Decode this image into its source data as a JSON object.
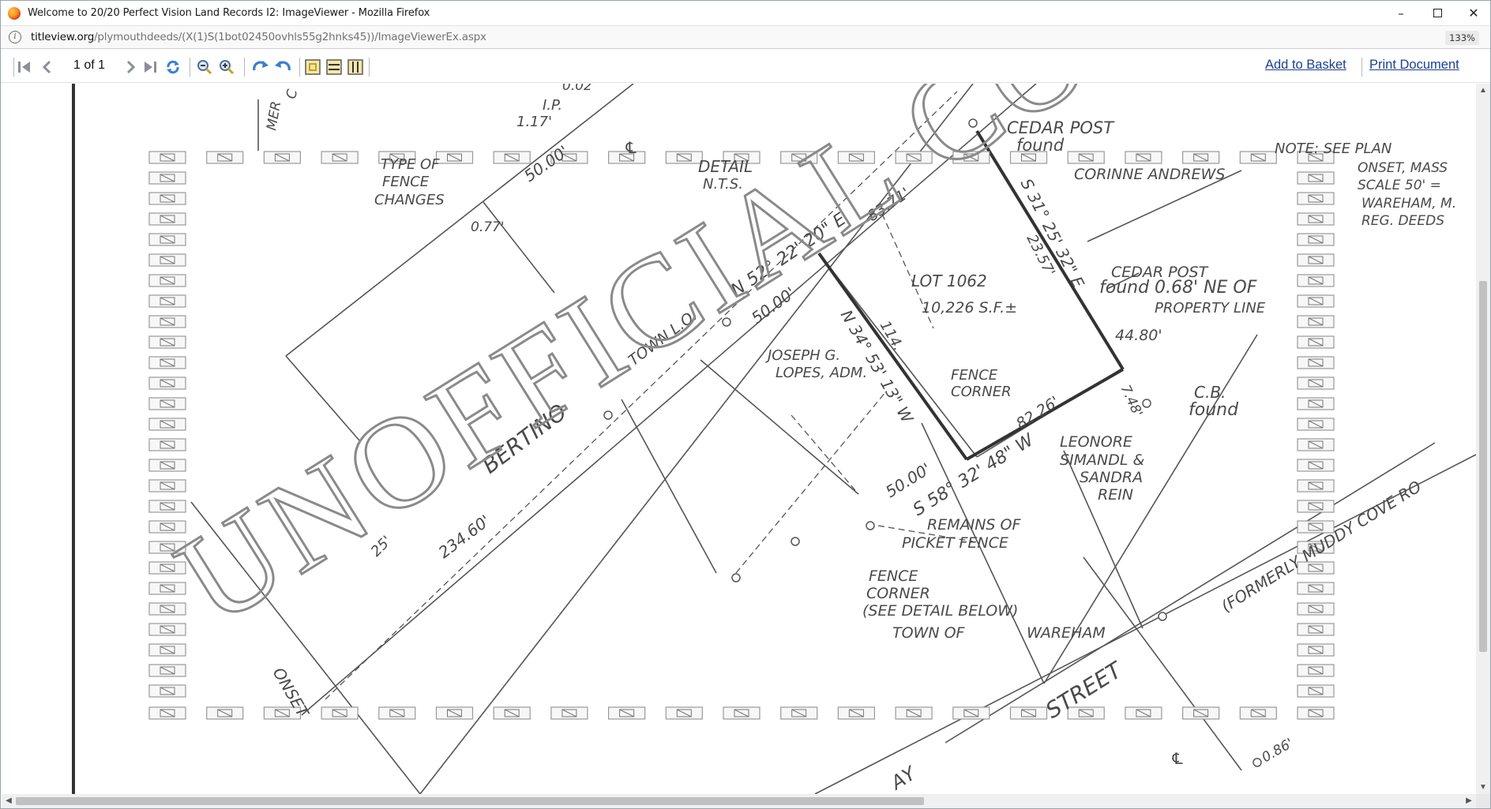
{
  "window": {
    "title": "Welcome to 20/20 Perfect Vision Land Records I2: ImageViewer - Mozilla Firefox",
    "minimize_glyph": "–",
    "close_glyph": "✕"
  },
  "urlbar": {
    "domain": "titleview.org",
    "path": "/plymouthdeeds/(X(1)S(1bot02450ovhls55g2hnks45))/ImageViewerEx.aspx",
    "zoom": "133%",
    "info_glyph": "i"
  },
  "toolbar": {
    "page_indicator": "1 of 1",
    "add_to_basket": "Add to Basket",
    "print_document": "Print Document"
  },
  "scrollbars": {
    "up": "▲",
    "down": "▼",
    "left": "◀",
    "right": "▶"
  },
  "colors": {
    "link": "#1c3f94",
    "nav_icon": "#8a8f99",
    "rotate_icon": "#3a7fd0",
    "fit_icon": "#c8a020",
    "watermark_outline": "#8a8a8a"
  },
  "drawing": {
    "labels": {
      "mer": "MER",
      "c": "C",
      "ip": "I.P.",
      "ip_dist": "1.17'",
      "top_dist": "0.02'",
      "type_of_fence_1": "TYPE OF",
      "type_of_fence_2": "FENCE",
      "type_of_fence_3": "CHANGES",
      "d_050": "50.00'",
      "d_077": "0.77'",
      "pl": "℄",
      "detail_1": "DETAIL",
      "detail_2": "N.T.S.",
      "cedar_post_1": "CEDAR POST",
      "found_1": "found",
      "corinne": "CORINNE ANDREWS",
      "note_1": "NOTE:  SEE PLAN",
      "note_2": "ONSET, MASS",
      "note_3": "SCALE 50' =",
      "note_4": "WAREHAM, M.",
      "note_5": "REG. DEEDS",
      "bearing_n52": "N 52° 22' 20\" E",
      "d_8371": "83.71'",
      "bearing_s31": "S 31° 25' 32\" E",
      "d_2357": "23.57'",
      "cedar_post_2": "CEDAR POST",
      "found_2": "found  0.68' NE OF",
      "property_line": "PROPERTY LINE",
      "d_4480": "44.80'",
      "lot": "LOT  1062",
      "lot_area": "10,226 S.F.±",
      "d_5000_a": "50.00'",
      "town_lo": "TOWN L.O.",
      "joseph_1": "JOSEPH G.",
      "joseph_2": "LOPES, ADM.",
      "bearing_n34": "N 34° 53' 13\" W",
      "d_114": "114.",
      "fence_corner_1": "FENCE",
      "fence_corner_2": "CORNER",
      "d_8226": "82.26'",
      "d_748": "7.48'",
      "cb": "C.B.",
      "cb_found": "found",
      "bertino": "BERTINO",
      "leonore_1": "LEONORE",
      "leonore_2": "SIMANDL &",
      "leonore_3": "SANDRA",
      "leonore_4": "REIN",
      "bearing_s58": "S 58° 32' 48\" W",
      "d_5000_b": "50.00'",
      "remains_1": "REMAINS OF",
      "remains_2": "PICKET FENCE",
      "fence_corner_3": "FENCE",
      "fence_corner_4": "CORNER",
      "fence_corner_5": "(SEE DETAIL BELOW)",
      "town_of": "TOWN  OF",
      "wareham": "WAREHAM",
      "d_23460": "234.60'",
      "d_25": "25'",
      "onset": "ONSET",
      "street": "STREET",
      "formerly": "(FORMERLY MUDDY COVE RO",
      "d_086": "0.86'",
      "bay": "AY",
      "pl2": "℄"
    },
    "watermark": "UNOFFICIAL COPY"
  }
}
